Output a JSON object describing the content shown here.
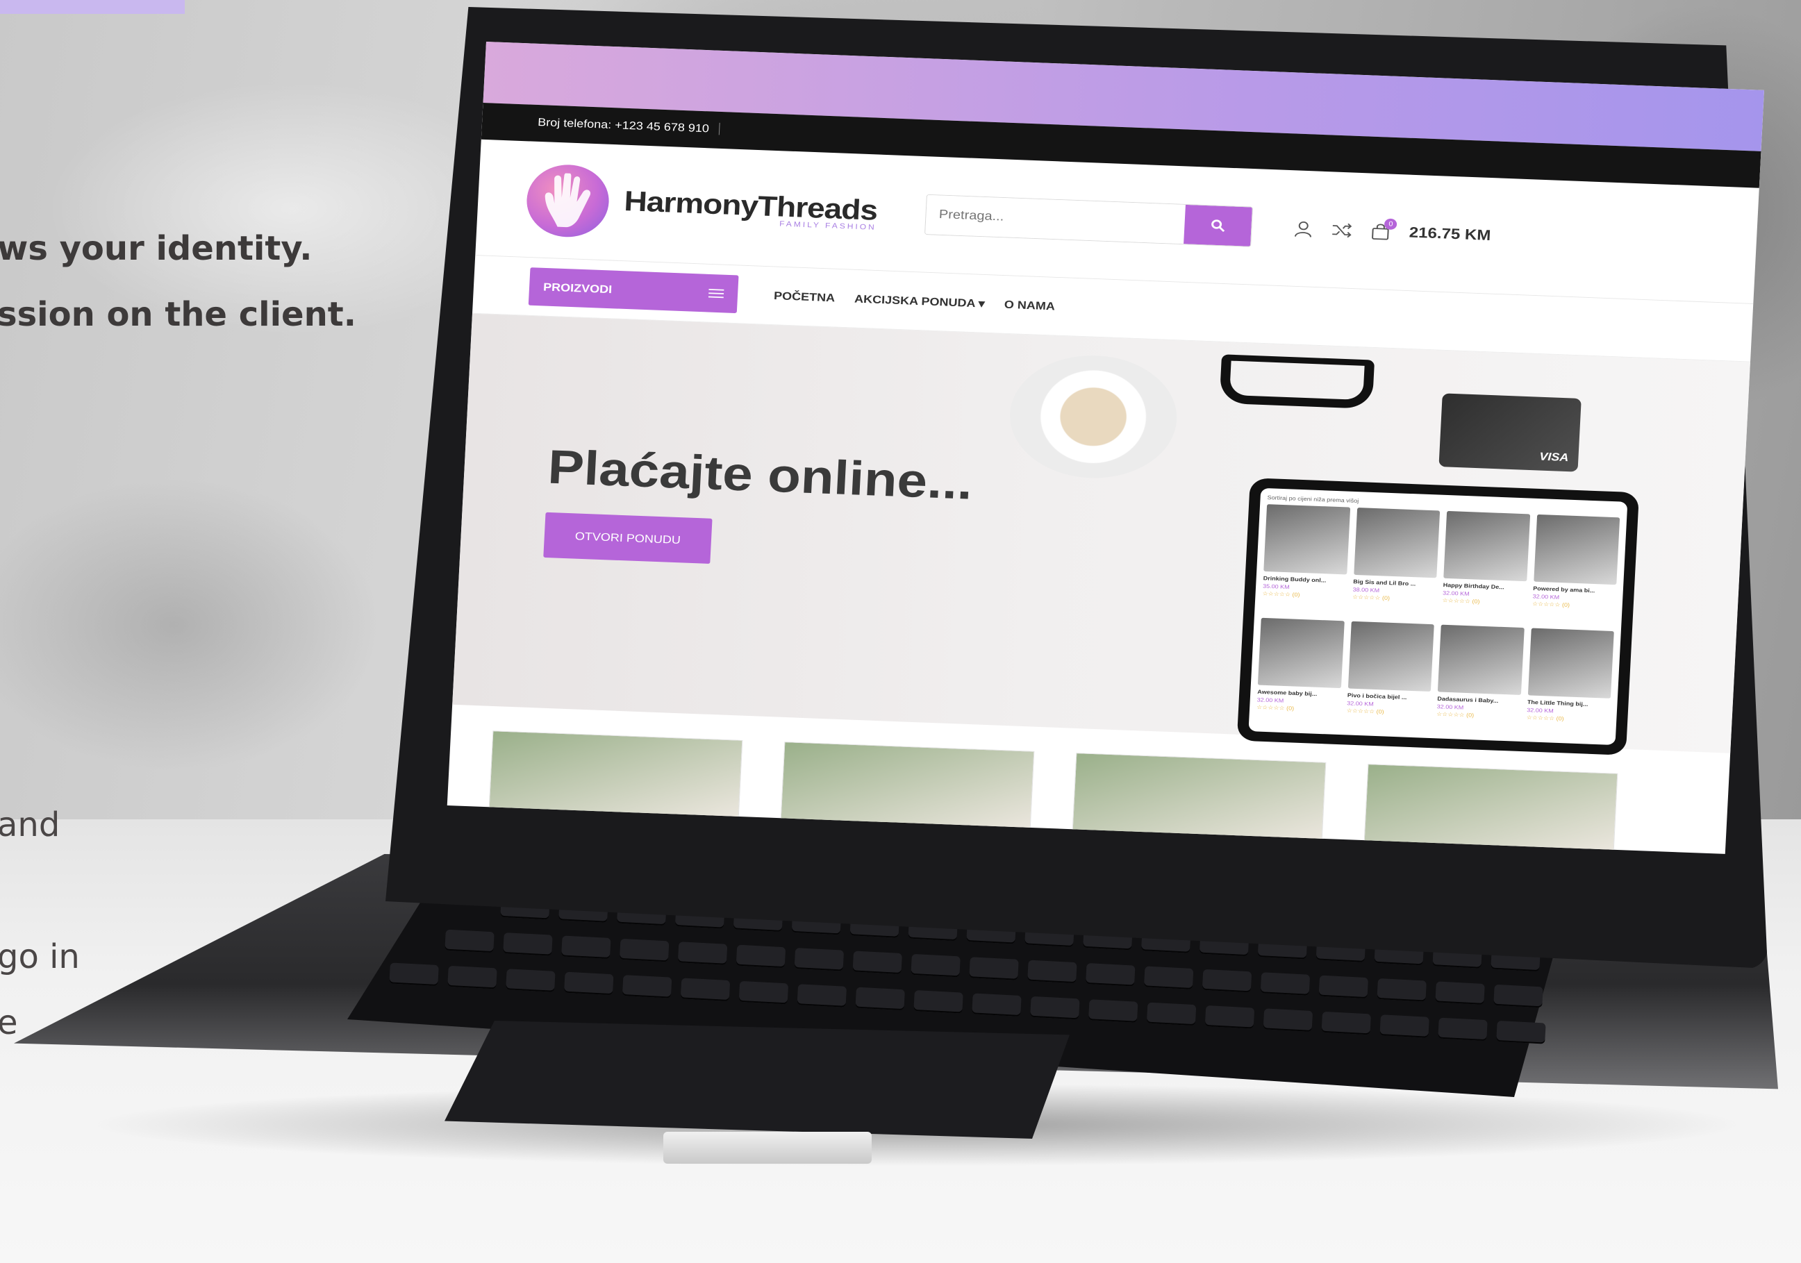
{
  "left_panel": {
    "line1": "ws your identity.",
    "line2": "ssion on the client.",
    "line3": "and",
    "line4": "go in",
    "line5": "e"
  },
  "site": {
    "phone": "Broj telefona: +123 45 678 910",
    "brand": {
      "name": "HarmonyThreads",
      "tagline": "FAMILY FASHION"
    },
    "search": {
      "placeholder": "Pretraga..."
    },
    "cart": {
      "count": "0",
      "total": "216.75 KM"
    },
    "categories_button": "PROIZVODI",
    "nav": [
      "POČETNA",
      "AKCIJSKA PONUDA ▾",
      "O NAMA"
    ],
    "hero": {
      "title": "Plaćajte online...",
      "button": "OTVORI PONUDU"
    },
    "card_brand": "VISA",
    "tablet": {
      "sort_label": "Sortiraj po cijeni niža prema višoj",
      "products": [
        {
          "name": "Drinking Buddy onl...",
          "price": "35.00 KM",
          "stars": "☆☆☆☆☆ (0)"
        },
        {
          "name": "Big Sis and Lil Bro ...",
          "price": "38.00 KM",
          "stars": "☆☆☆☆☆ (0)"
        },
        {
          "name": "Happy Birthday De...",
          "price": "32.00 KM",
          "stars": "☆☆☆☆☆ (0)"
        },
        {
          "name": "Powered by ama bi...",
          "price": "32.00 KM",
          "stars": "☆☆☆☆☆ (0)"
        },
        {
          "name": "Awesome baby bij...",
          "price": "32.00 KM",
          "stars": "☆☆☆☆☆ (0)"
        },
        {
          "name": "Pivo i bočica bijel ...",
          "price": "32.00 KM",
          "stars": "☆☆☆☆☆ (0)"
        },
        {
          "name": "Dadasaurus i Baby...",
          "price": "32.00 KM",
          "stars": "☆☆☆☆☆ (0)"
        },
        {
          "name": "The Little Thing bij...",
          "price": "32.00 KM",
          "stars": "☆☆☆☆☆ (0)"
        }
      ]
    }
  },
  "colors": {
    "accent": "#b565d9",
    "gradient_start": "#d9a9dc",
    "gradient_end": "#a595ec",
    "side_accent": "#c9b8ef"
  }
}
